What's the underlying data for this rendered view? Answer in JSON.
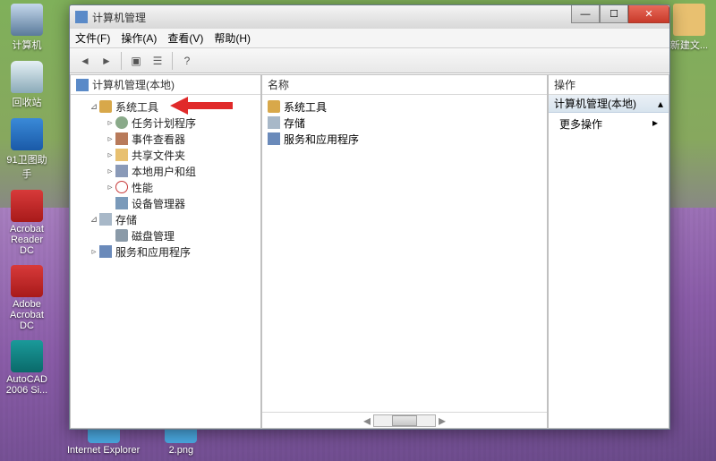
{
  "desktop": {
    "left_icons": [
      {
        "label": "计算机",
        "style": "monitor"
      },
      {
        "label": "回收站",
        "style": "bin"
      },
      {
        "label": "91卫图助手",
        "style": "blue"
      },
      {
        "label": "Acrobat Reader DC",
        "style": "red"
      },
      {
        "label": "Adobe Acrobat DC",
        "style": "red"
      },
      {
        "label": "AutoCAD 2006 Si...",
        "style": "teal"
      }
    ],
    "bottom_icons": [
      {
        "label": "Internet Explorer"
      },
      {
        "label": "2.png"
      }
    ],
    "right_icons": [
      {
        "label": "新建文..."
      }
    ]
  },
  "window": {
    "title": "计算机管理",
    "menu": [
      "文件(F)",
      "操作(A)",
      "查看(V)",
      "帮助(H)"
    ],
    "tree_header": "计算机管理(本地)",
    "tree": {
      "root": "计算机管理(本地)",
      "system_tools": "系统工具",
      "task_scheduler": "任务计划程序",
      "event_viewer": "事件查看器",
      "shared_folders": "共享文件夹",
      "local_users": "本地用户和组",
      "performance": "性能",
      "device_manager": "设备管理器",
      "storage": "存储",
      "disk_management": "磁盘管理",
      "services": "服务和应用程序"
    },
    "mid_header": "名称",
    "mid_items": {
      "system_tools": "系统工具",
      "storage": "存储",
      "services": "服务和应用程序"
    },
    "actions": {
      "header": "操作",
      "section": "计算机管理(本地)",
      "more": "更多操作"
    }
  }
}
